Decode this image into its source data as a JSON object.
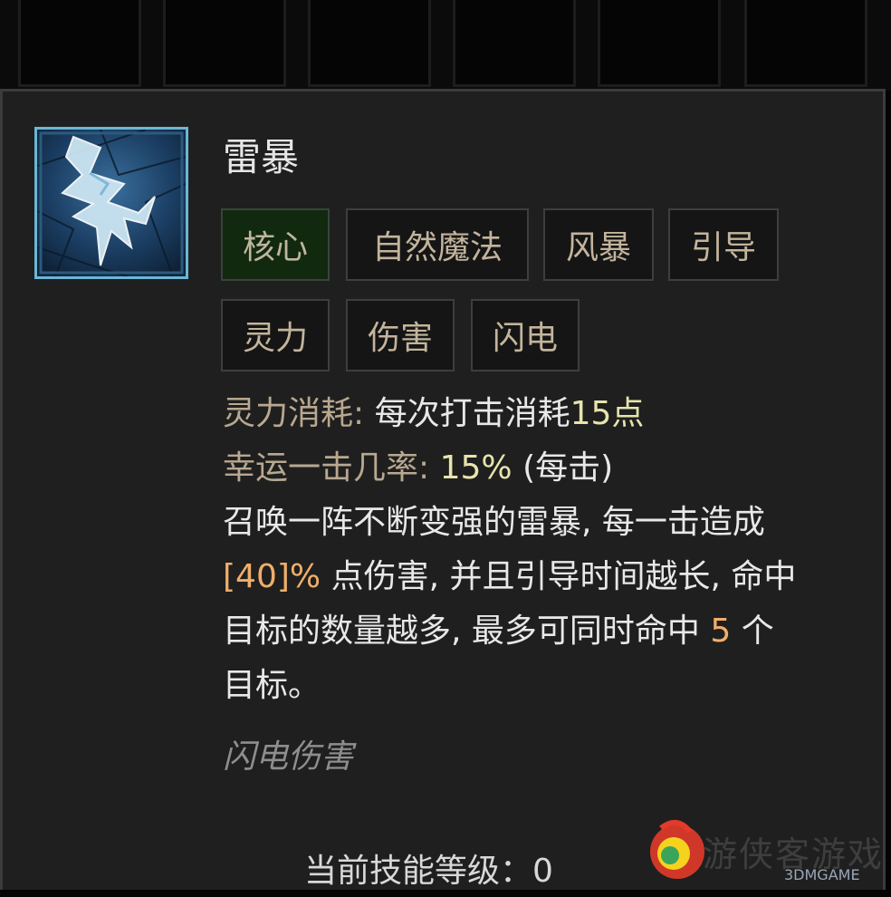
{
  "skill": {
    "name": "雷暴",
    "icon": "lightning-storm-icon",
    "tags": [
      "核心",
      "自然魔法",
      "风暴",
      "引导",
      "灵力",
      "伤害",
      "闪电"
    ]
  },
  "stats": {
    "cost_label": "灵力消耗:",
    "cost_text_a": "每次打击消耗",
    "cost_value": "15点",
    "crit_label": "幸运一击几率:",
    "crit_value": "15%",
    "crit_suffix": "(每击)"
  },
  "description": {
    "line1": "召唤一阵不断变强的雷暴, 每一击造成",
    "line2_value": "[40]%",
    "line2_text": "点伤害, 并且引导时间越长, 命中",
    "line3_text": "目标的数量越多, 最多可同时命中",
    "line3_value": "5",
    "line3_suffix": "个",
    "line4": "目标。"
  },
  "damage_type": "闪电伤害",
  "current_level": "当前技能等级：0",
  "watermark": {
    "text": "游侠客游戏",
    "brand": "3DMGAME"
  },
  "colors": {
    "tag_core_bg": "#10290f",
    "label": "#b8a890",
    "value_green": "#e7e4ad",
    "value_orange": "#f0ae6a",
    "icon_border": "#6bb6d6"
  }
}
